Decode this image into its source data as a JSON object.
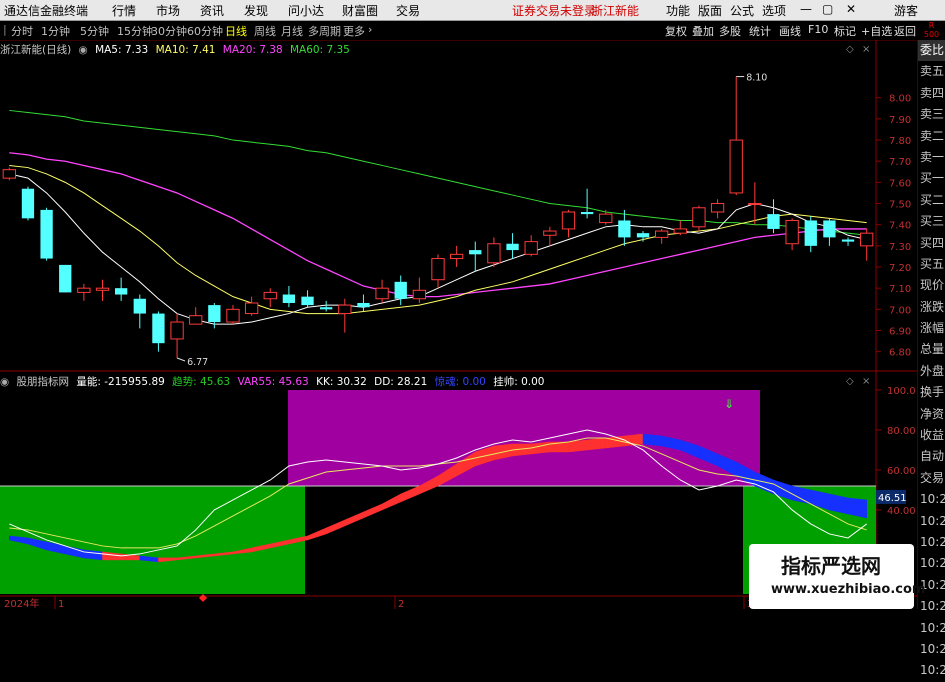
{
  "menu": {
    "logo": "通达信金融终端",
    "items": [
      "行情",
      "市场",
      "资讯",
      "发现",
      "问小达",
      "财富圈",
      "交易"
    ],
    "alert": "证券交易未登录",
    "stock_link": "浙江新能",
    "right": [
      "功能",
      "版面",
      "公式",
      "选项"
    ],
    "guest": "游客"
  },
  "toolbar": {
    "periods": [
      "分时",
      "1分钟",
      "5分钟",
      "15分钟",
      "30分钟",
      "60分钟",
      "日线",
      "周线",
      "月线",
      "多周期",
      "更多"
    ],
    "active_period": "日线",
    "right": [
      "复权",
      "叠加",
      "多股",
      "统计",
      "画线",
      "F10",
      "标记",
      "+自选",
      "返回"
    ],
    "r_badge_top": "R",
    "r_badge_bottom": "500"
  },
  "main_legend": {
    "name": "浙江新能(日线)",
    "ma5": "MA5: 7.33",
    "ma10": "MA10: 7.41",
    "ma20": "MA20: 7.38",
    "ma60": "MA60: 7.35"
  },
  "main_axis": {
    "labels": [
      "8.00",
      "7.90",
      "7.80",
      "7.70",
      "7.60",
      "7.50",
      "7.40",
      "7.30",
      "7.20",
      "7.10",
      "7.00",
      "6.90",
      "6.80"
    ],
    "ylim": [
      6.77,
      8.15
    ]
  },
  "annotations": {
    "high": "8.10",
    "low": "6.77"
  },
  "indicator_legend": {
    "name": "股朋指标网",
    "vol": "量能: -215955.89",
    "trend": "趋势: 45.63",
    "var55": "VAR55: 45.63",
    "kk": "KK: 30.32",
    "dd": "DD: 28.21",
    "yinhun": "惊魂: 0.00",
    "guashuai": "挂帅: 0.00"
  },
  "indicator_axis": {
    "labels": [
      "100.0",
      "80.00",
      "60.00",
      "40.00"
    ],
    "current": "46.51"
  },
  "date_axis": {
    "year": "2024年",
    "marks": [
      "1",
      "2",
      "3"
    ]
  },
  "side_column": [
    "委比",
    "卖五",
    "卖四",
    "卖三",
    "卖二",
    "卖一",
    "买一",
    "买二",
    "买三",
    "买四",
    "买五",
    "现价",
    "涨跌",
    "涨幅",
    "总量",
    "外盘",
    "换手",
    "净资",
    "收益",
    "自动",
    "交易",
    "10:20",
    "10:20",
    "10:20",
    "10:20",
    "10:20",
    "10:20",
    "10:20",
    "10:20",
    "10:20"
  ],
  "watermark": {
    "title": "指标严选网",
    "url": "www.xuezhibiao.com"
  },
  "colors": {
    "up": "#ff3a3a",
    "down": "#54ffff",
    "ma5": "#ffffff",
    "ma10": "#ffff66",
    "ma20": "#ff44ff",
    "ma60": "#33dd33",
    "purple": "#a000a0",
    "green": "#00a000"
  },
  "chart_data": {
    "type": "candlestick",
    "candles": [
      [
        7.62,
        7.66,
        7.67,
        7.61
      ],
      [
        7.57,
        7.43,
        7.58,
        7.42
      ],
      [
        7.47,
        7.24,
        7.48,
        7.23
      ],
      [
        7.21,
        7.08,
        7.21,
        7.08
      ],
      [
        7.08,
        7.1,
        7.12,
        7.04
      ],
      [
        7.09,
        7.1,
        7.14,
        7.04
      ],
      [
        7.1,
        7.07,
        7.15,
        7.04
      ],
      [
        7.05,
        6.98,
        7.07,
        6.91
      ],
      [
        6.98,
        6.84,
        6.99,
        6.8
      ],
      [
        6.86,
        6.94,
        6.98,
        6.77
      ],
      [
        6.93,
        6.97,
        7.01,
        6.93
      ],
      [
        7.02,
        6.94,
        7.03,
        6.91
      ],
      [
        6.94,
        7.0,
        7.02,
        6.93
      ],
      [
        6.98,
        7.03,
        7.06,
        6.97
      ],
      [
        7.05,
        7.08,
        7.1,
        7.01
      ],
      [
        7.07,
        7.03,
        7.11,
        7.01
      ],
      [
        7.06,
        7.02,
        7.09,
        7.01
      ],
      [
        7.01,
        7.0,
        7.04,
        6.99
      ],
      [
        6.98,
        7.02,
        7.05,
        6.89
      ],
      [
        7.03,
        7.01,
        7.07,
        6.99
      ],
      [
        7.05,
        7.1,
        7.14,
        7.03
      ],
      [
        7.13,
        7.05,
        7.16,
        7.02
      ],
      [
        7.05,
        7.09,
        7.15,
        7.03
      ],
      [
        7.14,
        7.24,
        7.26,
        7.1
      ],
      [
        7.24,
        7.26,
        7.3,
        7.2
      ],
      [
        7.28,
        7.26,
        7.32,
        7.18
      ],
      [
        7.22,
        7.31,
        7.34,
        7.2
      ],
      [
        7.31,
        7.28,
        7.36,
        7.24
      ],
      [
        7.26,
        7.32,
        7.35,
        7.25
      ],
      [
        7.35,
        7.37,
        7.39,
        7.3
      ],
      [
        7.38,
        7.46,
        7.47,
        7.34
      ],
      [
        7.46,
        7.45,
        7.57,
        7.43
      ],
      [
        7.41,
        7.45,
        7.47,
        7.4
      ],
      [
        7.42,
        7.34,
        7.47,
        7.3
      ],
      [
        7.36,
        7.34,
        7.37,
        7.32
      ],
      [
        7.34,
        7.37,
        7.38,
        7.31
      ],
      [
        7.36,
        7.38,
        7.42,
        7.35
      ],
      [
        7.39,
        7.48,
        7.49,
        7.37
      ],
      [
        7.46,
        7.5,
        7.52,
        7.43
      ],
      [
        7.55,
        7.8,
        8.1,
        7.54
      ],
      [
        7.5,
        7.5,
        7.6,
        7.4
      ],
      [
        7.45,
        7.38,
        7.52,
        7.36
      ],
      [
        7.31,
        7.42,
        7.43,
        7.28
      ],
      [
        7.42,
        7.3,
        7.44,
        7.27
      ],
      [
        7.42,
        7.34,
        7.43,
        7.3
      ],
      [
        7.33,
        7.32,
        7.34,
        7.3
      ],
      [
        7.3,
        7.36,
        7.38,
        7.23
      ]
    ],
    "ma5": [
      7.64,
      7.62,
      7.55,
      7.46,
      7.36,
      7.27,
      7.2,
      7.13,
      7.05,
      6.98,
      6.95,
      6.93,
      6.93,
      6.94,
      6.96,
      6.98,
      7.01,
      7.02,
      7.02,
      7.01,
      7.03,
      7.05,
      7.06,
      7.1,
      7.14,
      7.18,
      7.21,
      7.24,
      7.27,
      7.3,
      7.33,
      7.36,
      7.39,
      7.4,
      7.39,
      7.39,
      7.37,
      7.36,
      7.38,
      7.47,
      7.5,
      7.48,
      7.45,
      7.41,
      7.39,
      7.35,
      7.33
    ],
    "ma10": [
      7.68,
      7.67,
      7.64,
      7.6,
      7.55,
      7.49,
      7.43,
      7.37,
      7.3,
      7.22,
      7.16,
      7.11,
      7.06,
      7.03,
      7.0,
      6.99,
      6.98,
      6.98,
      6.98,
      6.99,
      7.0,
      7.01,
      7.02,
      7.04,
      7.06,
      7.09,
      7.11,
      7.13,
      7.16,
      7.19,
      7.22,
      7.25,
      7.28,
      7.31,
      7.33,
      7.35,
      7.36,
      7.37,
      7.38,
      7.4,
      7.42,
      7.44,
      7.45,
      7.44,
      7.43,
      7.42,
      7.41
    ],
    "ma20": [
      7.74,
      7.73,
      7.71,
      7.7,
      7.68,
      7.66,
      7.64,
      7.61,
      7.58,
      7.55,
      7.51,
      7.47,
      7.43,
      7.38,
      7.33,
      7.28,
      7.23,
      7.19,
      7.15,
      7.11,
      7.09,
      7.07,
      7.06,
      7.06,
      7.07,
      7.08,
      7.09,
      7.1,
      7.11,
      7.12,
      7.14,
      7.16,
      7.18,
      7.2,
      7.22,
      7.24,
      7.26,
      7.28,
      7.3,
      7.32,
      7.34,
      7.35,
      7.36,
      7.37,
      7.38,
      7.38,
      7.38
    ],
    "ma60": [
      7.94,
      7.93,
      7.92,
      7.91,
      7.89,
      7.88,
      7.87,
      7.86,
      7.85,
      7.84,
      7.83,
      7.82,
      7.8,
      7.79,
      7.78,
      7.77,
      7.75,
      7.74,
      7.72,
      7.7,
      7.68,
      7.66,
      7.64,
      7.62,
      7.6,
      7.58,
      7.56,
      7.54,
      7.52,
      7.5,
      7.49,
      7.48,
      7.46,
      7.45,
      7.44,
      7.43,
      7.42,
      7.42,
      7.41,
      7.41,
      7.4,
      7.4,
      7.39,
      7.38,
      7.37,
      7.36,
      7.35
    ],
    "indicator": {
      "white": [
        33,
        29,
        25,
        22,
        19,
        18,
        17,
        18,
        20,
        22,
        30,
        40,
        45,
        50,
        55,
        62,
        64,
        65,
        64,
        63,
        62,
        60,
        61,
        63,
        66,
        70,
        73,
        75,
        74,
        76,
        78,
        80,
        78,
        75,
        70,
        62,
        55,
        50,
        52,
        55,
        53,
        49,
        40,
        33,
        28,
        26,
        33
      ],
      "yellow": [
        31,
        30,
        28,
        26,
        24,
        22,
        21,
        21,
        21,
        23,
        27,
        32,
        37,
        42,
        47,
        53,
        56,
        59,
        60,
        61,
        62,
        62,
        62,
        63,
        64,
        66,
        68,
        70,
        71,
        73,
        74,
        76,
        76,
        74,
        72,
        68,
        64,
        60,
        58,
        57,
        55,
        53,
        48,
        43,
        38,
        33,
        30
      ],
      "band_low": [
        25,
        23,
        20,
        18,
        16,
        15,
        15,
        15,
        14,
        15,
        16,
        17,
        18,
        19,
        21,
        23,
        25,
        28,
        32,
        36,
        40,
        44,
        48,
        52,
        57,
        62,
        65,
        67,
        68,
        69,
        69,
        70,
        71,
        72,
        73,
        72,
        70,
        66,
        62,
        57,
        52,
        48,
        45,
        43,
        40,
        38,
        36
      ],
      "band_high": [
        27,
        26,
        24,
        22,
        20,
        19,
        18,
        17,
        16,
        16,
        17,
        18,
        19,
        21,
        23,
        25,
        27,
        31,
        35,
        39,
        43,
        48,
        52,
        57,
        63,
        69,
        72,
        73,
        73,
        74,
        74,
        75,
        76,
        77,
        78,
        77,
        75,
        72,
        68,
        64,
        59,
        55,
        52,
        50,
        48,
        46,
        45
      ]
    }
  }
}
